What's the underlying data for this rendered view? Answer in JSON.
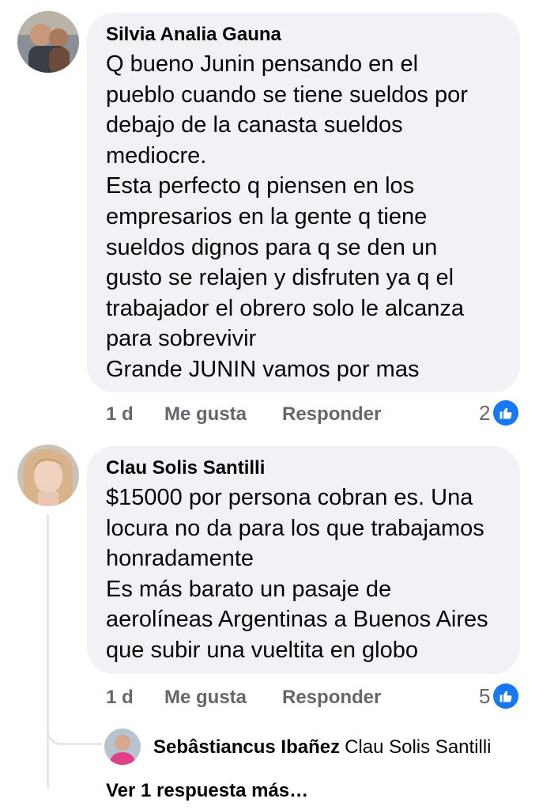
{
  "comments": [
    {
      "author": "Silvia Analia Gauna",
      "avatar_icon": "user-photo-avatar",
      "text": "Q bueno Junin pensando en el\npueblo cuando se tiene sueldos por\ndebajo de la canasta sueldos\nmediocre.\nEsta perfecto q piensen en los\nempresarios en la gente q tiene\nsueldos dignos para q se den un\ngusto se relajen y disfruten ya q el\ntrabajador el obrero solo le alcanza\npara sobrevivir\nGrande JUNIN vamos por mas",
      "time": "1 d",
      "like_label": "Me gusta",
      "reply_label": "Responder",
      "reaction_count": "2",
      "reaction_icon": "like-icon"
    },
    {
      "author": "Clau Solis Santilli",
      "avatar_icon": "user-photo-avatar",
      "text": "$15000  por persona cobran es. Una\nlocura no da para los que trabajamos\nhonradamente\nEs más barato un pasaje de\naerolíneas Argentinas a Buenos Aires\nque subir una vueltita en globo",
      "time": "1 d",
      "like_label": "Me gusta",
      "reply_label": "Responder",
      "reaction_count": "5",
      "reaction_icon": "like-icon"
    }
  ],
  "reply": {
    "author": "Sebâstiancus Ibañez",
    "mention": "Clau Solis Santilli"
  },
  "view_more": "Ver 1 respuesta más…",
  "colors": {
    "bubble": "#f0f2f5",
    "secondary_text": "#65676b",
    "like_blue": "#1877f2",
    "thread_line": "#e4e6eb"
  }
}
